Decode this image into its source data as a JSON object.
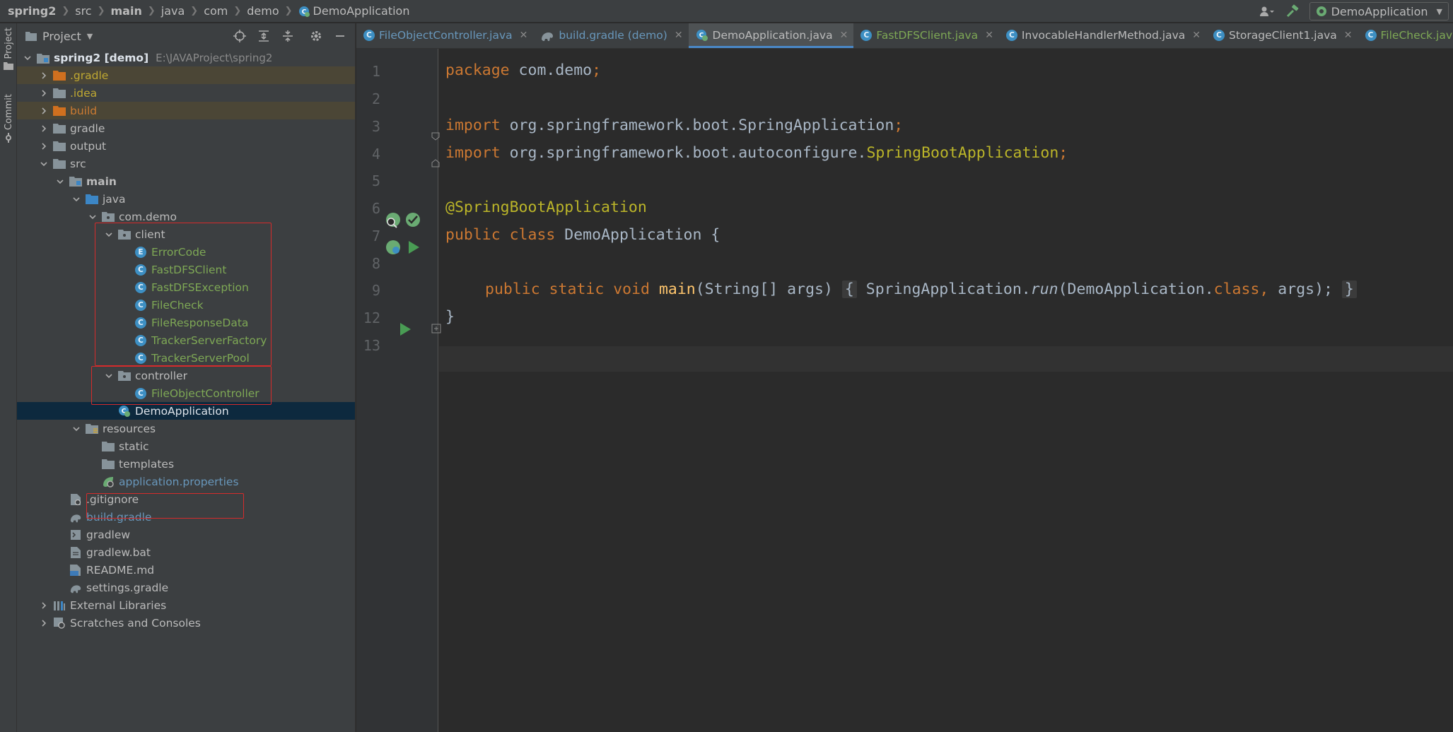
{
  "breadcrumb": [
    "spring2",
    "src",
    "main",
    "java",
    "com",
    "demo",
    "DemoApplication"
  ],
  "run_config": {
    "label": "DemoApplication"
  },
  "toolstrip": {
    "project_tab": "Project",
    "commit_tab": "Commit"
  },
  "project_panel": {
    "title": "Project",
    "root": {
      "name": "spring2 [demo]",
      "path": "E:\\JAVAProject\\spring2"
    },
    "items": {
      "gradle_dir": ".gradle",
      "idea_dir": ".idea",
      "build_dir": "build",
      "gradle_folder": "gradle",
      "output": "output",
      "src": "src",
      "main": "main",
      "java": "java",
      "com_demo": "com.demo",
      "client": "client",
      "error_code": "ErrorCode",
      "fastdfs_client": "FastDFSClient",
      "fastdfs_exception": "FastDFSException",
      "file_check": "FileCheck",
      "file_response_data": "FileResponseData",
      "tracker_server_factory": "TrackerServerFactory",
      "tracker_server_pool": "TrackerServerPool",
      "controller": "controller",
      "file_object_controller": "FileObjectController",
      "demo_application": "DemoApplication",
      "resources": "resources",
      "static": "static",
      "templates": "templates",
      "application_properties": "application.properties",
      "gitignore": ".gitignore",
      "build_gradle": "build.gradle",
      "gradlew": "gradlew",
      "gradlew_bat": "gradlew.bat",
      "readme": "README.md",
      "settings_gradle": "settings.gradle",
      "external_libraries": "External Libraries",
      "scratches": "Scratches and Consoles"
    }
  },
  "tabs": [
    {
      "label": "FileObjectController.java"
    },
    {
      "label": "build.gradle (demo)"
    },
    {
      "label": "DemoApplication.java"
    },
    {
      "label": "FastDFSClient.java"
    },
    {
      "label": "InvocableHandlerMethod.java"
    },
    {
      "label": "StorageClient1.java"
    },
    {
      "label": "FileCheck.java"
    }
  ],
  "line_numbers": [
    "1",
    "2",
    "3",
    "4",
    "5",
    "6",
    "7",
    "8",
    "9",
    "12",
    "13"
  ],
  "code": {
    "l1_kw": "package",
    "l1_rest": " com.demo",
    "l1_semi": ";",
    "l3_kw": "import",
    "l3_rest": " org.springframework.boot.SpringApplication",
    "l3_semi": ";",
    "l4_kw": "import",
    "l4_rest": " org.springframework.boot.autoconfigure.",
    "l4_ann": "SpringBootApplication",
    "l4_semi": ";",
    "l6_ann": "@SpringBootApplication",
    "l7_kw": "public class",
    "l7_rest": " DemoApplication {",
    "l9_kw": "public static void",
    "l9_fn": "main",
    "l9_args": "(String[] args)",
    "l9_open": "{",
    "l9_call": " SpringApplication.",
    "l9_run": "run",
    "l9_callargs": "(DemoApplication.",
    "l9_cls": "class",
    "l9_comma": ",",
    "l9_args2": " args);",
    "l9_close": "}",
    "l12": "}"
  },
  "colors": {
    "background": "#2b2b2b",
    "panel": "#3c3f41",
    "keyword": "#cc7832",
    "annotation": "#bbb529",
    "function": "#ffc66d",
    "selection": "#0d293e",
    "highlight_box": "#d62b2b",
    "active_tab_underline": "#4a88c7"
  }
}
